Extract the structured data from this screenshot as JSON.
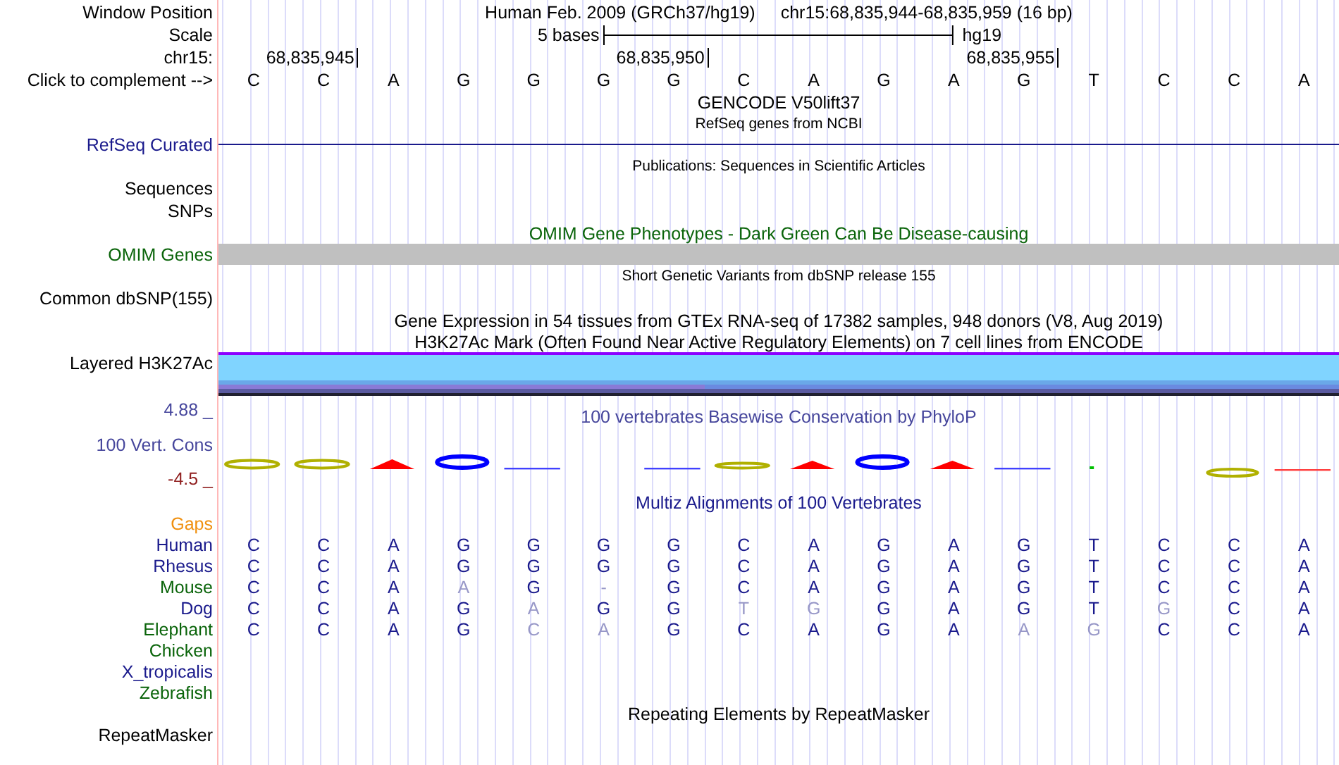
{
  "window_position": {
    "label": "Window Position",
    "assembly": "Human Feb. 2009 (GRCh37/hg19)",
    "range": "chr15:68,835,944-68,835,959 (16 bp)"
  },
  "scale": {
    "label": "Scale",
    "length": "5 bases",
    "assembly": "hg19"
  },
  "ruler": {
    "label": "chr15:",
    "ticks": [
      "68,835,945",
      "68,835,950",
      "68,835,955"
    ]
  },
  "complement": {
    "label": "Click to complement -->",
    "bases": [
      "C",
      "C",
      "A",
      "G",
      "G",
      "G",
      "G",
      "C",
      "A",
      "G",
      "A",
      "G",
      "T",
      "C",
      "C",
      "A"
    ]
  },
  "tracks": [
    {
      "kind": "title",
      "title": "GENCODE V50lift37"
    },
    {
      "kind": "subtitle",
      "title": "RefSeq genes from NCBI"
    },
    {
      "kind": "line",
      "label": "RefSeq Curated",
      "color": "#1a1a8c"
    },
    {
      "kind": "subtitle",
      "title": "Publications: Sequences in Scientific Articles"
    },
    {
      "kind": "label",
      "label": "Sequences",
      "color": "#000000"
    },
    {
      "kind": "label",
      "label": "SNPs",
      "color": "#000000"
    },
    {
      "kind": "title",
      "title": "OMIM Gene Phenotypes - Dark Green Can Be Disease-causing",
      "color": "#0a640a"
    },
    {
      "kind": "bar",
      "label": "OMIM Genes",
      "color": "#0a640a"
    },
    {
      "kind": "subtitle",
      "title": "Short Genetic Variants from dbSNP release 155"
    },
    {
      "kind": "label",
      "label": "Common dbSNP(155)",
      "color": "#000000"
    },
    {
      "kind": "title",
      "title": "Gene Expression in 54 tissues from GTEx RNA-seq of 17382 samples, 948 donors (V8, Aug 2019)",
      "color": "#000000"
    },
    {
      "kind": "title",
      "title": "H3K27Ac Mark (Often Found Near Active Regulatory Elements) on 7 cell lines from ENCODE",
      "color": "#000000"
    },
    {
      "kind": "layered",
      "label": "Layered H3K27Ac",
      "color": "#000000"
    },
    {
      "kind": "conservation",
      "label": "100 Vert. Cons",
      "max": "4.88 _",
      "min": "-4.5 _",
      "title": "100 vertebrates Basewise Conservation by PhyloP",
      "color": "#46469c"
    },
    {
      "kind": "alignment",
      "title": "Multiz Alignments of 100 Vertebrates",
      "gaps_label": "Gaps",
      "species": [
        {
          "name": "Human",
          "color": "#1a1a8c",
          "bases": [
            {
              "base": "C",
              "faded": false
            },
            {
              "base": "C",
              "faded": false
            },
            {
              "base": "A",
              "faded": false
            },
            {
              "base": "G",
              "faded": false
            },
            {
              "base": "G",
              "faded": false
            },
            {
              "base": "G",
              "faded": false
            },
            {
              "base": "G",
              "faded": false
            },
            {
              "base": "C",
              "faded": false
            },
            {
              "base": "A",
              "faded": false
            },
            {
              "base": "G",
              "faded": false
            },
            {
              "base": "A",
              "faded": false
            },
            {
              "base": "G",
              "faded": false
            },
            {
              "base": "T",
              "faded": false
            },
            {
              "base": "C",
              "faded": false
            },
            {
              "base": "C",
              "faded": false
            },
            {
              "base": "A",
              "faded": false
            }
          ]
        },
        {
          "name": "Rhesus",
          "color": "#1a1a8c",
          "bases": [
            {
              "base": "C",
              "faded": false
            },
            {
              "base": "C",
              "faded": false
            },
            {
              "base": "A",
              "faded": false
            },
            {
              "base": "G",
              "faded": false
            },
            {
              "base": "G",
              "faded": false
            },
            {
              "base": "G",
              "faded": false
            },
            {
              "base": "G",
              "faded": false
            },
            {
              "base": "C",
              "faded": false
            },
            {
              "base": "A",
              "faded": false
            },
            {
              "base": "G",
              "faded": false
            },
            {
              "base": "A",
              "faded": false
            },
            {
              "base": "G",
              "faded": false
            },
            {
              "base": "T",
              "faded": false
            },
            {
              "base": "C",
              "faded": false
            },
            {
              "base": "C",
              "faded": false
            },
            {
              "base": "A",
              "faded": false
            }
          ]
        },
        {
          "name": "Mouse",
          "color": "#0a640a",
          "bases": [
            {
              "base": "C",
              "faded": false
            },
            {
              "base": "C",
              "faded": false
            },
            {
              "base": "A",
              "faded": false
            },
            {
              "base": "A",
              "faded": true
            },
            {
              "base": "G",
              "faded": false
            },
            {
              "base": "-",
              "faded": true
            },
            {
              "base": "G",
              "faded": false
            },
            {
              "base": "C",
              "faded": false
            },
            {
              "base": "A",
              "faded": false
            },
            {
              "base": "G",
              "faded": false
            },
            {
              "base": "A",
              "faded": false
            },
            {
              "base": "G",
              "faded": false
            },
            {
              "base": "T",
              "faded": false
            },
            {
              "base": "C",
              "faded": false
            },
            {
              "base": "C",
              "faded": false
            },
            {
              "base": "A",
              "faded": false
            }
          ]
        },
        {
          "name": "Dog",
          "color": "#1a1a8c",
          "bases": [
            {
              "base": "C",
              "faded": false
            },
            {
              "base": "C",
              "faded": false
            },
            {
              "base": "A",
              "faded": false
            },
            {
              "base": "G",
              "faded": false
            },
            {
              "base": "A",
              "faded": true
            },
            {
              "base": "G",
              "faded": false
            },
            {
              "base": "G",
              "faded": false
            },
            {
              "base": "T",
              "faded": true
            },
            {
              "base": "G",
              "faded": true
            },
            {
              "base": "G",
              "faded": false
            },
            {
              "base": "A",
              "faded": false
            },
            {
              "base": "G",
              "faded": false
            },
            {
              "base": "T",
              "faded": false
            },
            {
              "base": "G",
              "faded": true
            },
            {
              "base": "C",
              "faded": false
            },
            {
              "base": "A",
              "faded": false
            }
          ]
        },
        {
          "name": "Elephant",
          "color": "#0a640a",
          "bases": [
            {
              "base": "C",
              "faded": false
            },
            {
              "base": "C",
              "faded": false
            },
            {
              "base": "A",
              "faded": false
            },
            {
              "base": "G",
              "faded": false
            },
            {
              "base": "C",
              "faded": true
            },
            {
              "base": "A",
              "faded": true
            },
            {
              "base": "G",
              "faded": false
            },
            {
              "base": "C",
              "faded": false
            },
            {
              "base": "A",
              "faded": false
            },
            {
              "base": "G",
              "faded": false
            },
            {
              "base": "A",
              "faded": false
            },
            {
              "base": "A",
              "faded": true
            },
            {
              "base": "G",
              "faded": true
            },
            {
              "base": "C",
              "faded": false
            },
            {
              "base": "C",
              "faded": false
            },
            {
              "base": "A",
              "faded": false
            }
          ]
        },
        {
          "name": "Chicken",
          "color": "#0a640a"
        },
        {
          "name": "X_tropicalis",
          "color": "#1a1a8c"
        },
        {
          "name": "Zebrafish",
          "color": "#0a640a"
        }
      ]
    },
    {
      "kind": "title",
      "title": "Repeating Elements by RepeatMasker",
      "color": "#000000"
    },
    {
      "kind": "label",
      "label": "RepeatMasker",
      "color": "#000000"
    }
  ]
}
